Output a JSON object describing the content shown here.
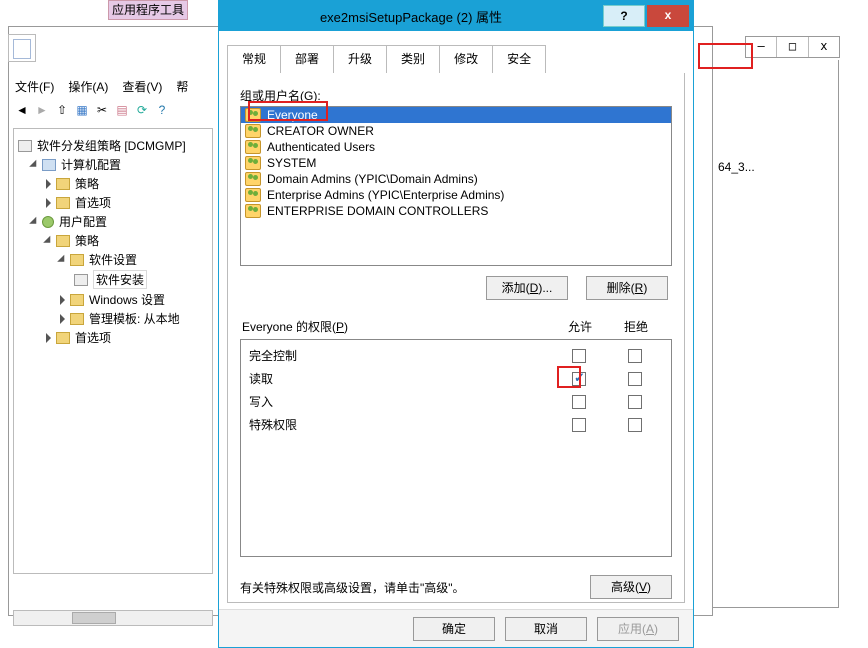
{
  "app_tools_tab": "应用程序工具",
  "bg_item": "64_3...",
  "bg_buttons": {
    "min": "–",
    "max": "□",
    "close": "x"
  },
  "menubar": {
    "file": "文件(F)",
    "action": "操作(A)",
    "view": "查看(V)",
    "help": "帮"
  },
  "tree": {
    "root": "软件分发组策略 [DCMGMP]",
    "computer": "计算机配置",
    "policy": "策略",
    "pref": "首选项",
    "user": "用户配置",
    "soft_settings": "软件设置",
    "soft_install": "软件安装",
    "win_settings": "Windows 设置",
    "admin_tpl": "管理模板: 从本地"
  },
  "dialog": {
    "title": "exe2msiSetupPackage (2) 属性",
    "help": "?",
    "close": "x",
    "tabs": {
      "general": "常规",
      "deploy": "部署",
      "upgrade": "升级",
      "category": "类别",
      "modify": "修改",
      "security": "安全"
    },
    "group_label_pre": "组或用户名(",
    "group_label_u": "G",
    "group_label_post": "):",
    "users": [
      {
        "name": "Everyone"
      },
      {
        "name": "CREATOR OWNER"
      },
      {
        "name": "Authenticated Users"
      },
      {
        "name": "SYSTEM"
      },
      {
        "name": "Domain Admins (YPIC\\Domain Admins)"
      },
      {
        "name": "Enterprise Admins (YPIC\\Enterprise Admins)"
      },
      {
        "name": "ENTERPRISE DOMAIN CONTROLLERS"
      }
    ],
    "add_btn_pre": "添加(",
    "add_btn_u": "D",
    "add_btn_post": ")...",
    "del_btn_pre": "删除(",
    "del_btn_u": "R",
    "del_btn_post": ")",
    "perm_label_pre": "Everyone 的权限(",
    "perm_label_u": "P",
    "perm_label_post": ")",
    "allow": "允许",
    "deny": "拒绝",
    "perms": {
      "full": "完全控制",
      "read": "读取",
      "write": "写入",
      "special": "特殊权限"
    },
    "adv_msg": "有关特殊权限或高级设置，请单击\"高级\"。",
    "adv_btn_pre": "高级(",
    "adv_btn_u": "V",
    "adv_btn_post": ")",
    "ok": "确定",
    "cancel": "取消",
    "apply_pre": "应用(",
    "apply_u": "A",
    "apply_post": ")"
  }
}
